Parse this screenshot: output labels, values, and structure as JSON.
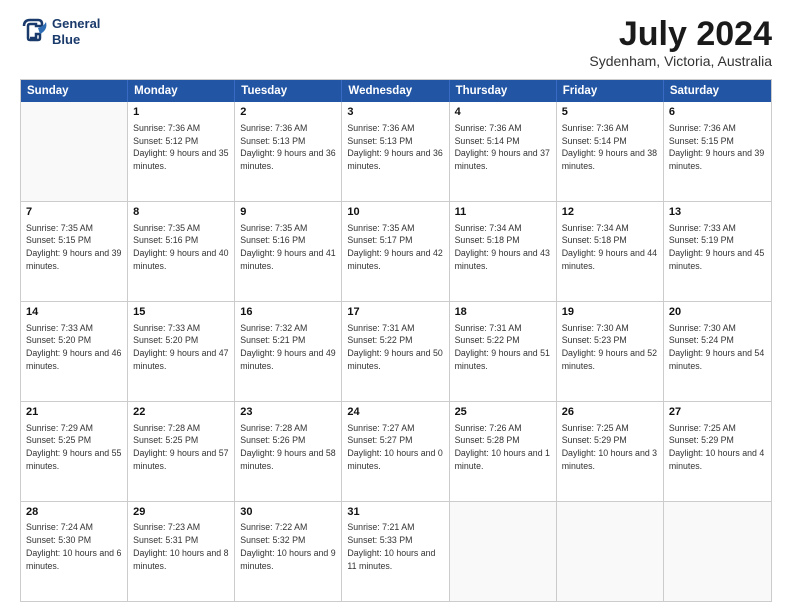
{
  "logo": {
    "line1": "General",
    "line2": "Blue"
  },
  "title": "July 2024",
  "location": "Sydenham, Victoria, Australia",
  "days_of_week": [
    "Sunday",
    "Monday",
    "Tuesday",
    "Wednesday",
    "Thursday",
    "Friday",
    "Saturday"
  ],
  "weeks": [
    [
      {
        "day": "",
        "empty": true
      },
      {
        "day": "1",
        "sunrise": "Sunrise: 7:36 AM",
        "sunset": "Sunset: 5:12 PM",
        "daylight": "Daylight: 9 hours and 35 minutes."
      },
      {
        "day": "2",
        "sunrise": "Sunrise: 7:36 AM",
        "sunset": "Sunset: 5:13 PM",
        "daylight": "Daylight: 9 hours and 36 minutes."
      },
      {
        "day": "3",
        "sunrise": "Sunrise: 7:36 AM",
        "sunset": "Sunset: 5:13 PM",
        "daylight": "Daylight: 9 hours and 36 minutes."
      },
      {
        "day": "4",
        "sunrise": "Sunrise: 7:36 AM",
        "sunset": "Sunset: 5:14 PM",
        "daylight": "Daylight: 9 hours and 37 minutes."
      },
      {
        "day": "5",
        "sunrise": "Sunrise: 7:36 AM",
        "sunset": "Sunset: 5:14 PM",
        "daylight": "Daylight: 9 hours and 38 minutes."
      },
      {
        "day": "6",
        "sunrise": "Sunrise: 7:36 AM",
        "sunset": "Sunset: 5:15 PM",
        "daylight": "Daylight: 9 hours and 39 minutes."
      }
    ],
    [
      {
        "day": "7",
        "sunrise": "Sunrise: 7:35 AM",
        "sunset": "Sunset: 5:15 PM",
        "daylight": "Daylight: 9 hours and 39 minutes."
      },
      {
        "day": "8",
        "sunrise": "Sunrise: 7:35 AM",
        "sunset": "Sunset: 5:16 PM",
        "daylight": "Daylight: 9 hours and 40 minutes."
      },
      {
        "day": "9",
        "sunrise": "Sunrise: 7:35 AM",
        "sunset": "Sunset: 5:16 PM",
        "daylight": "Daylight: 9 hours and 41 minutes."
      },
      {
        "day": "10",
        "sunrise": "Sunrise: 7:35 AM",
        "sunset": "Sunset: 5:17 PM",
        "daylight": "Daylight: 9 hours and 42 minutes."
      },
      {
        "day": "11",
        "sunrise": "Sunrise: 7:34 AM",
        "sunset": "Sunset: 5:18 PM",
        "daylight": "Daylight: 9 hours and 43 minutes."
      },
      {
        "day": "12",
        "sunrise": "Sunrise: 7:34 AM",
        "sunset": "Sunset: 5:18 PM",
        "daylight": "Daylight: 9 hours and 44 minutes."
      },
      {
        "day": "13",
        "sunrise": "Sunrise: 7:33 AM",
        "sunset": "Sunset: 5:19 PM",
        "daylight": "Daylight: 9 hours and 45 minutes."
      }
    ],
    [
      {
        "day": "14",
        "sunrise": "Sunrise: 7:33 AM",
        "sunset": "Sunset: 5:20 PM",
        "daylight": "Daylight: 9 hours and 46 minutes."
      },
      {
        "day": "15",
        "sunrise": "Sunrise: 7:33 AM",
        "sunset": "Sunset: 5:20 PM",
        "daylight": "Daylight: 9 hours and 47 minutes."
      },
      {
        "day": "16",
        "sunrise": "Sunrise: 7:32 AM",
        "sunset": "Sunset: 5:21 PM",
        "daylight": "Daylight: 9 hours and 49 minutes."
      },
      {
        "day": "17",
        "sunrise": "Sunrise: 7:31 AM",
        "sunset": "Sunset: 5:22 PM",
        "daylight": "Daylight: 9 hours and 50 minutes."
      },
      {
        "day": "18",
        "sunrise": "Sunrise: 7:31 AM",
        "sunset": "Sunset: 5:22 PM",
        "daylight": "Daylight: 9 hours and 51 minutes."
      },
      {
        "day": "19",
        "sunrise": "Sunrise: 7:30 AM",
        "sunset": "Sunset: 5:23 PM",
        "daylight": "Daylight: 9 hours and 52 minutes."
      },
      {
        "day": "20",
        "sunrise": "Sunrise: 7:30 AM",
        "sunset": "Sunset: 5:24 PM",
        "daylight": "Daylight: 9 hours and 54 minutes."
      }
    ],
    [
      {
        "day": "21",
        "sunrise": "Sunrise: 7:29 AM",
        "sunset": "Sunset: 5:25 PM",
        "daylight": "Daylight: 9 hours and 55 minutes."
      },
      {
        "day": "22",
        "sunrise": "Sunrise: 7:28 AM",
        "sunset": "Sunset: 5:25 PM",
        "daylight": "Daylight: 9 hours and 57 minutes."
      },
      {
        "day": "23",
        "sunrise": "Sunrise: 7:28 AM",
        "sunset": "Sunset: 5:26 PM",
        "daylight": "Daylight: 9 hours and 58 minutes."
      },
      {
        "day": "24",
        "sunrise": "Sunrise: 7:27 AM",
        "sunset": "Sunset: 5:27 PM",
        "daylight": "Daylight: 10 hours and 0 minutes."
      },
      {
        "day": "25",
        "sunrise": "Sunrise: 7:26 AM",
        "sunset": "Sunset: 5:28 PM",
        "daylight": "Daylight: 10 hours and 1 minute."
      },
      {
        "day": "26",
        "sunrise": "Sunrise: 7:25 AM",
        "sunset": "Sunset: 5:29 PM",
        "daylight": "Daylight: 10 hours and 3 minutes."
      },
      {
        "day": "27",
        "sunrise": "Sunrise: 7:25 AM",
        "sunset": "Sunset: 5:29 PM",
        "daylight": "Daylight: 10 hours and 4 minutes."
      }
    ],
    [
      {
        "day": "28",
        "sunrise": "Sunrise: 7:24 AM",
        "sunset": "Sunset: 5:30 PM",
        "daylight": "Daylight: 10 hours and 6 minutes."
      },
      {
        "day": "29",
        "sunrise": "Sunrise: 7:23 AM",
        "sunset": "Sunset: 5:31 PM",
        "daylight": "Daylight: 10 hours and 8 minutes."
      },
      {
        "day": "30",
        "sunrise": "Sunrise: 7:22 AM",
        "sunset": "Sunset: 5:32 PM",
        "daylight": "Daylight: 10 hours and 9 minutes."
      },
      {
        "day": "31",
        "sunrise": "Sunrise: 7:21 AM",
        "sunset": "Sunset: 5:33 PM",
        "daylight": "Daylight: 10 hours and 11 minutes."
      },
      {
        "day": "",
        "empty": true
      },
      {
        "day": "",
        "empty": true
      },
      {
        "day": "",
        "empty": true
      }
    ]
  ]
}
